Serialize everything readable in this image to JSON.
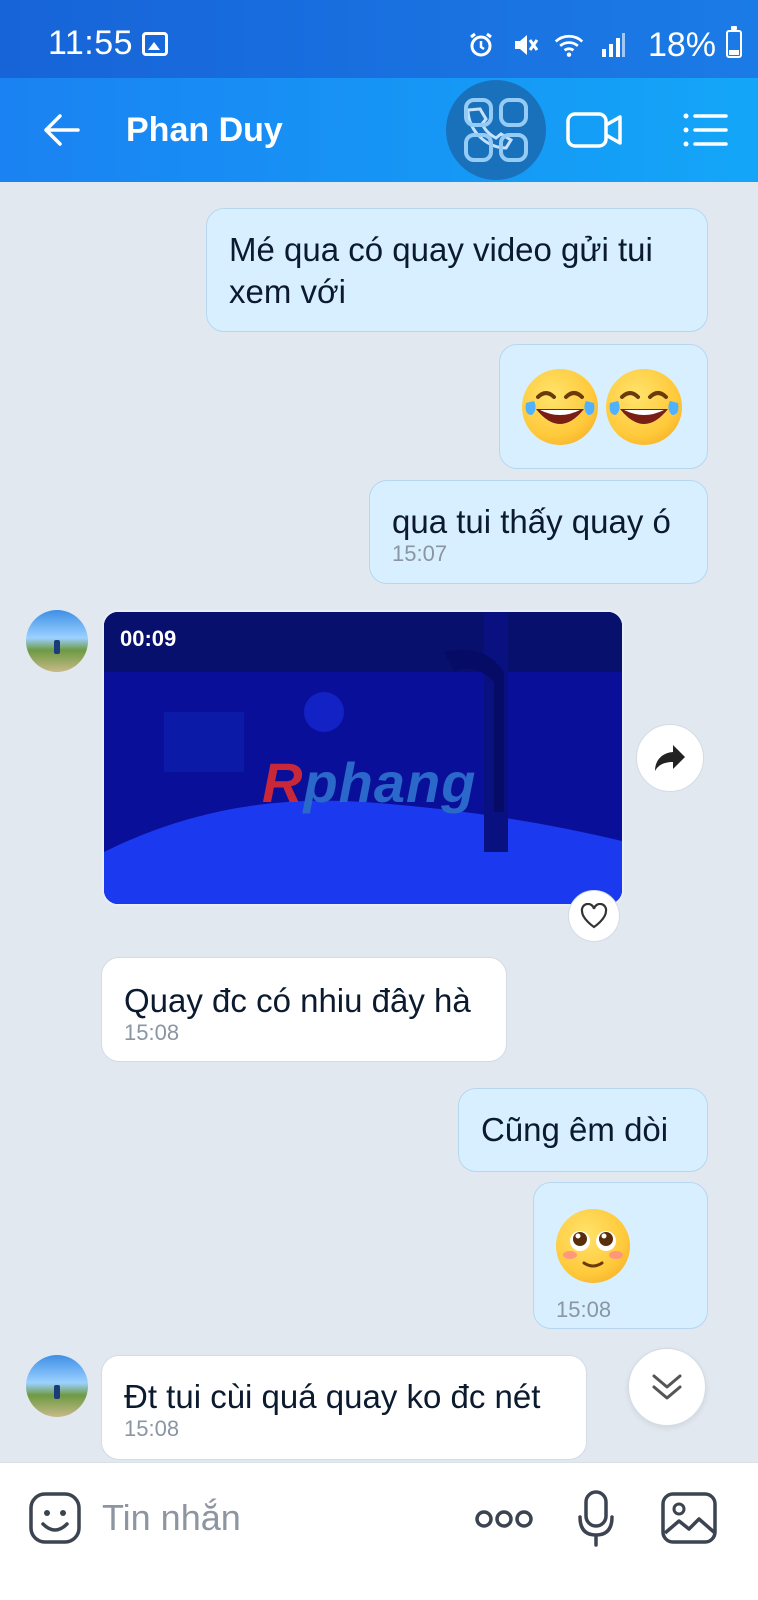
{
  "status_bar": {
    "time": "11:55",
    "battery": "18%"
  },
  "header": {
    "title": "Phan Duy"
  },
  "messages": {
    "m1": {
      "text": "Mé qua có quay video gửi tui xem với"
    },
    "m3": {
      "text": "qua tui thấy quay ó",
      "time": "15:07"
    },
    "video": {
      "duration": "00:09",
      "watermark_a": "R",
      "watermark_b": "phang"
    },
    "m4": {
      "text": "Quay đc có nhiu đây hà",
      "time": "15:08"
    },
    "m5": {
      "text": "Cũng êm dòi"
    },
    "m6": {
      "time": "15:08"
    },
    "m7": {
      "text": "Đt tui cùi quá quay ko đc nét",
      "time": "15:08"
    }
  },
  "composer": {
    "placeholder": "Tin nhắn"
  },
  "icons": {
    "back": "arrow-left-icon",
    "call": "phone-icon",
    "video": "video-camera-icon",
    "menu": "list-menu-icon",
    "forward": "share-forward-icon",
    "heart": "heart-icon",
    "scroll": "chevrons-down-icon",
    "sticker": "smiley-sticker-icon",
    "more": "more-dots-icon",
    "mic": "microphone-icon",
    "gallery": "image-gallery-icon"
  }
}
